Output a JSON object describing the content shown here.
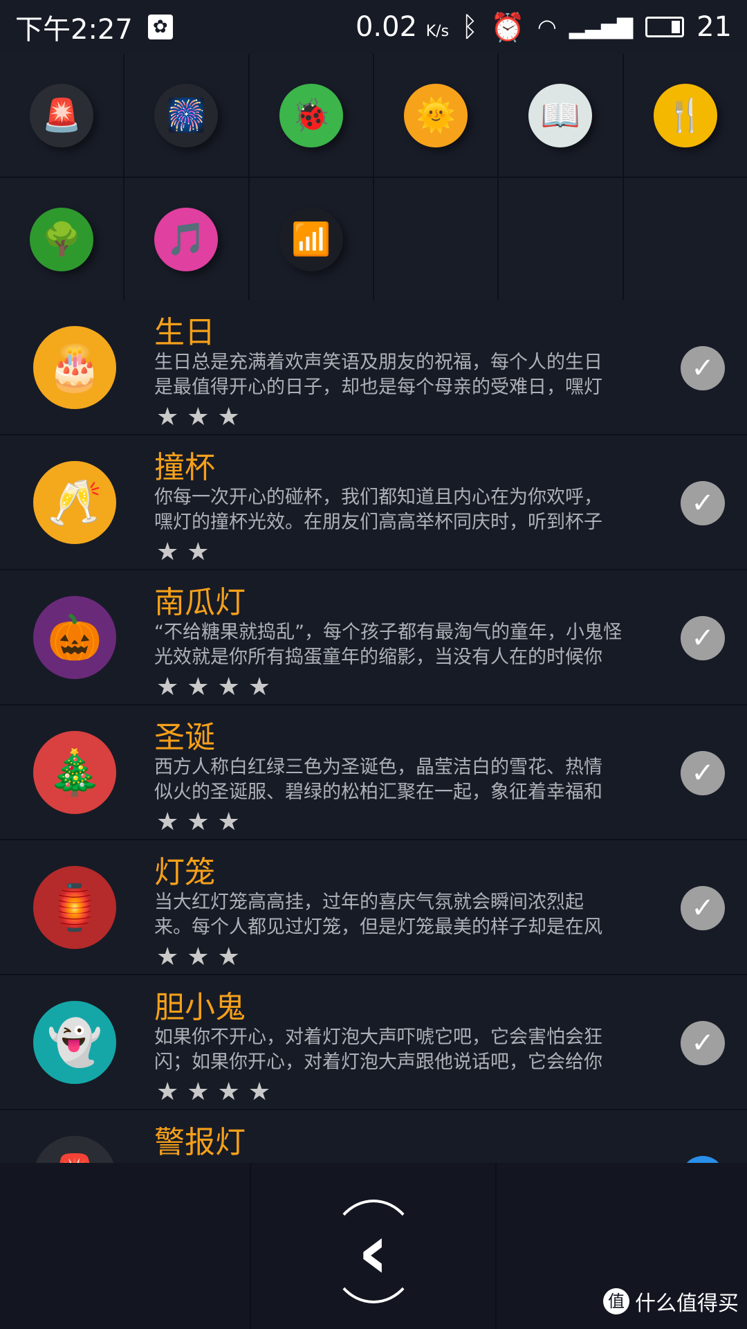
{
  "status": {
    "time": "下午2:27",
    "speed": "0.02",
    "speed_unit": "K/s",
    "battery": "21",
    "icons": [
      "notification-icon",
      "bluetooth-icon",
      "alarm-icon",
      "wifi-icon",
      "4g-signal-icon",
      "battery-icon"
    ]
  },
  "grid": [
    {
      "name": "police-light",
      "icon": "🚨",
      "color": "#2a2d33"
    },
    {
      "name": "fireworks",
      "icon": "🎆",
      "color": "#24272d"
    },
    {
      "name": "firefly",
      "icon": "🐞",
      "color": "#3cb54a"
    },
    {
      "name": "sun",
      "icon": "🌞",
      "color": "#f7a21b"
    },
    {
      "name": "book",
      "icon": "📖",
      "color": "#dde6e4"
    },
    {
      "name": "dining",
      "icon": "🍴",
      "color": "#f5b800"
    },
    {
      "name": "tree",
      "icon": "🌳",
      "color": "#2e9a2e"
    },
    {
      "name": "music",
      "icon": "🎵",
      "color": "#e040a0"
    },
    {
      "name": "equalizer",
      "icon": "📶",
      "color": "#1a1d24"
    }
  ],
  "items": [
    {
      "title": "生日",
      "line1": "生日总是充满着欢声笑语及朋友的祝福，每个人的生日",
      "line2": "是最值得开心的日子，却也是每个母亲的受难日，嘿灯",
      "stars": 3,
      "icon": "🎂",
      "color": "#f4a81c"
    },
    {
      "title": "撞杯",
      "line1": "你每一次开心的碰杯，我们都知道且内心在为你欢呼，",
      "line2": "嘿灯的撞杯光效。在朋友们高高举杯同庆时，听到杯子",
      "stars": 2,
      "icon": "🥂",
      "color": "#f4a81c"
    },
    {
      "title": "南瓜灯",
      "line1": "“不给糖果就捣乱”，每个孩子都有最淘气的童年，小鬼怪",
      "line2": "光效就是你所有捣蛋童年的缩影，当没有人在的时候你",
      "stars": 4,
      "icon": "🎃",
      "color": "#6a2a7a"
    },
    {
      "title": "圣诞",
      "line1": "西方人称白红绿三色为圣诞色，晶莹洁白的雪花、热情",
      "line2": "似火的圣诞服、碧绿的松柏汇聚在一起，象征着幸福和",
      "stars": 3,
      "icon": "🎄",
      "color": "#d8413f"
    },
    {
      "title": "灯笼",
      "line1": "当大红灯笼高高挂，过年的喜庆气氛就会瞬间浓烈起",
      "line2": "来。每个人都见过灯笼，但是灯笼最美的样子却是在风",
      "stars": 3,
      "icon": "🏮",
      "color": "#b52a2a"
    },
    {
      "title": "胆小鬼",
      "line1": "如果你不开心，对着灯泡大声吓唬它吧，它会害怕会狂",
      "line2": "闪；如果你开心，对着灯泡大声跟他说话吧，它会给你",
      "stars": 4,
      "icon": "👻",
      "color": "#15a7a8"
    },
    {
      "title": "警报灯",
      "line1": "",
      "line2": "",
      "stars": 0,
      "icon": "🚨",
      "color": "#2a2d33"
    }
  ],
  "nav": {
    "back": "back-icon"
  },
  "watermark": {
    "badge": "值",
    "text": "什么值得买"
  }
}
